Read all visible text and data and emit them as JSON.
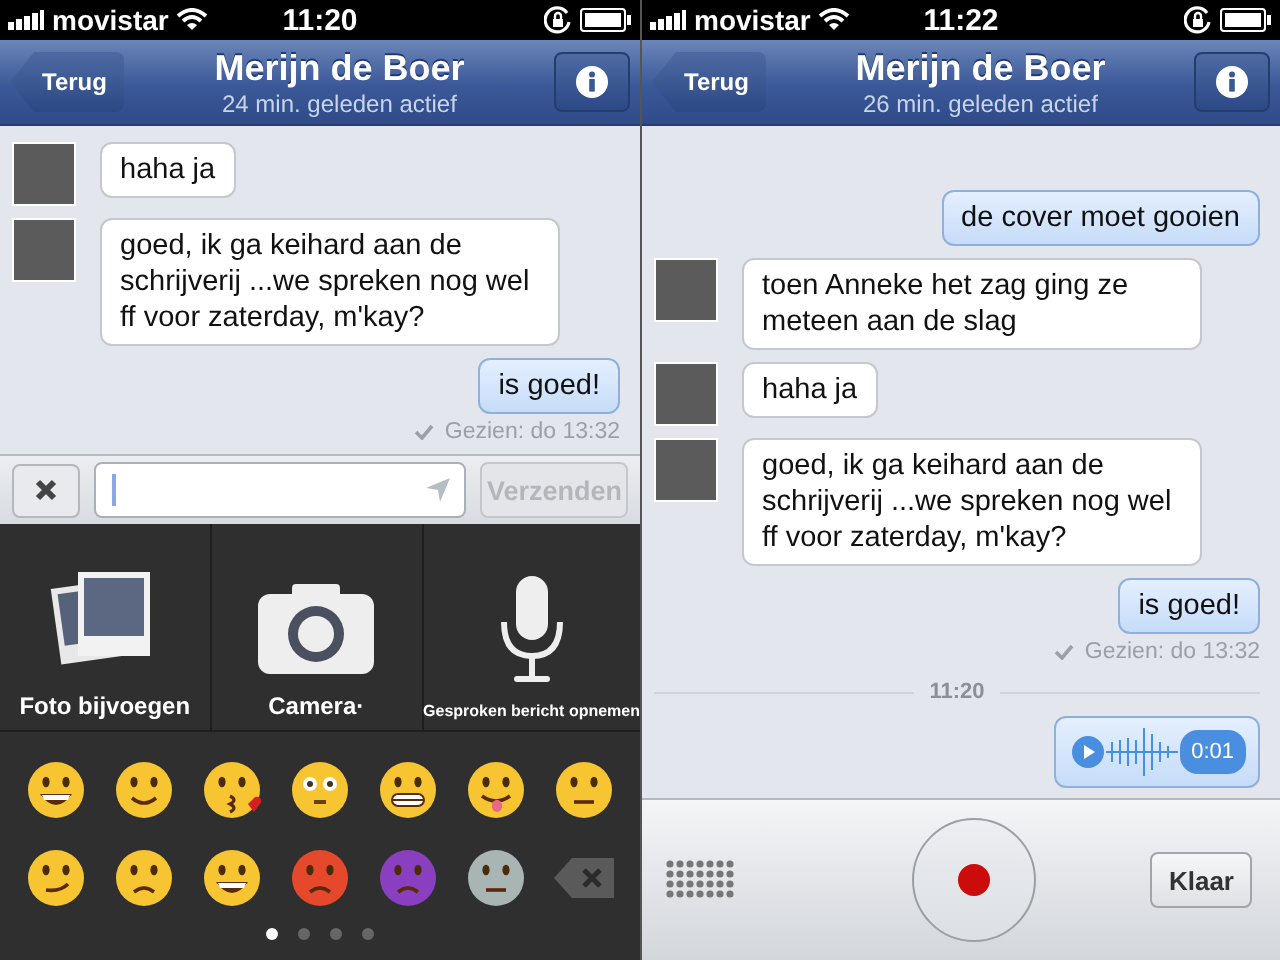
{
  "screens": [
    {
      "status_bar": {
        "carrier": "movistar",
        "time": "11:20"
      },
      "nav": {
        "back": "Terug",
        "title": "Merijn de Boer",
        "subtitle": "24 min. geleden actief"
      },
      "messages": [
        {
          "kind": "incoming",
          "text": "haha ja"
        },
        {
          "kind": "incoming",
          "text": "goed, ik ga keihard aan de schrijverij ...we spreken nog wel ff voor zaterday, m'kay?"
        },
        {
          "kind": "outgoing",
          "text": "is goed!"
        },
        {
          "kind": "seen",
          "text": "Gezien: do 13:32"
        }
      ],
      "composer": {
        "send": {
          "label": "Verzenden",
          "disabled": true
        }
      },
      "attachments": [
        {
          "kind": "photo",
          "label": "Foto bijvoegen"
        },
        {
          "kind": "camera",
          "label": "Camera·"
        },
        {
          "kind": "microphone",
          "label": "Gesproken bericht opnemen"
        }
      ],
      "emoji_pages": [
        {
          "selected": true
        },
        {
          "selected": false
        },
        {
          "selected": false
        },
        {
          "selected": false
        }
      ]
    },
    {
      "status_bar": {
        "carrier": "movistar",
        "time": "11:22"
      },
      "nav": {
        "back": "Terug",
        "title": "Merijn de Boer",
        "subtitle": "26 min. geleden actief"
      },
      "messages": [
        {
          "kind": "outgoing",
          "text": "de cover moet gooien"
        },
        {
          "kind": "incoming",
          "text": "toen Anneke het zag ging ze meteen aan de slag"
        },
        {
          "kind": "incoming",
          "text": "haha ja"
        },
        {
          "kind": "incoming",
          "text": "goed, ik ga keihard aan de schrijverij ...we spreken nog wel ff voor zaterday, m'kay?"
        },
        {
          "kind": "outgoing",
          "text": "is goed!"
        },
        {
          "kind": "seen",
          "text": "Gezien: do 13:32"
        },
        {
          "kind": "time",
          "text": "11:20"
        },
        {
          "kind": "voice",
          "duration": "0:01"
        }
      ],
      "recorder": {
        "done": "Klaar"
      }
    }
  ]
}
